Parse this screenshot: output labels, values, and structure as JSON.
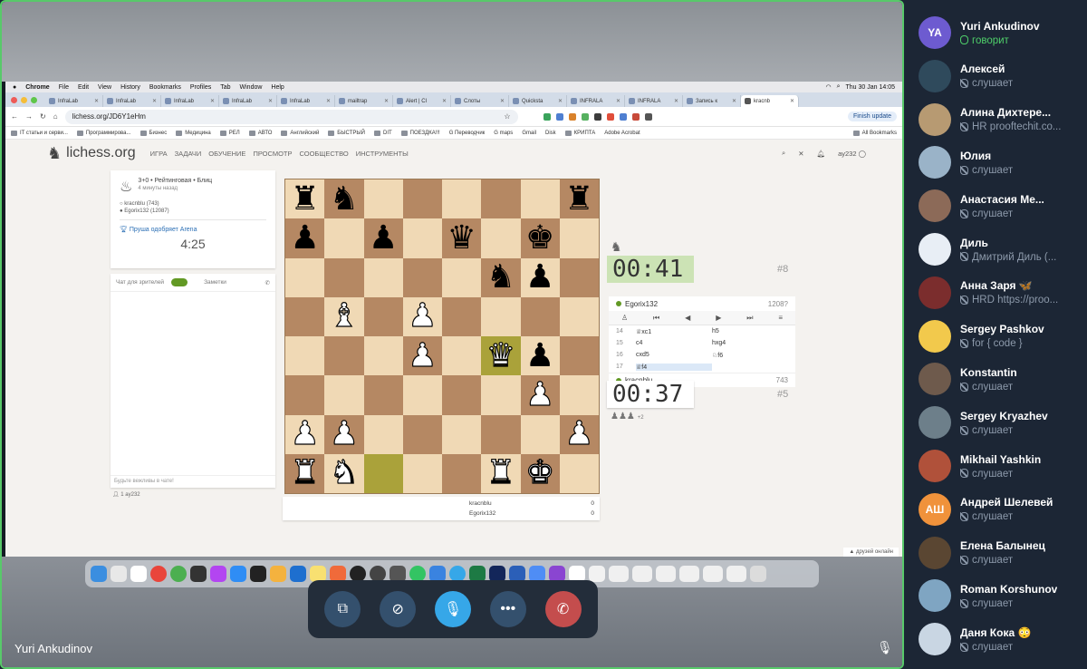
{
  "mac_menu": {
    "items": [
      "Chrome",
      "File",
      "Edit",
      "View",
      "History",
      "Bookmarks",
      "Profiles",
      "Tab",
      "Window",
      "Help"
    ],
    "clock": "Thu 30 Jan 14:05"
  },
  "tabs": [
    "InfraLab",
    "InfraLab",
    "InfraLab",
    "InfraLab",
    "InfraLab",
    "mailtrap",
    "Alert | Cl",
    "Слоты",
    "Quickstа",
    "INFRALA",
    "INFRALA",
    "Запись к",
    "kracnb"
  ],
  "address": {
    "url": "lichess.org/JD6Y1eHm",
    "finish_update": "Finish update"
  },
  "bookmarks": [
    "IT статьи и серви...",
    "Программирова...",
    "Бизнес",
    "Медицина",
    "РЕЛ",
    "АВТО",
    "Английский",
    "БЫСТРЫЙ",
    "DIT",
    "ПОЕЗДКА!!!",
    "G Переводчик",
    "G maps",
    "Gmail",
    "Disk",
    "КРИПТА",
    "Adobe Acrobat",
    "All Bookmarks"
  ],
  "lichess": {
    "logo": "lichess.org",
    "nav": [
      "ИГРА",
      "ЗАДАЧИ",
      "ОБУЧЕНИЕ",
      "ПРОСМОТР",
      "СООБЩЕСТВО",
      "ИНСТРУМЕНТЫ"
    ],
    "user": "ay232",
    "game": {
      "type": "3+0 • Рейтинговая • Блиц",
      "ago": "4 минуты назад",
      "white": "kracnblu (743)",
      "black": "Egorix132 (12087)",
      "arena": "Пруша одобряет Arena",
      "arena_time": "4:25"
    },
    "chat": {
      "tab1": "Чат для зрителей",
      "tab2": "Заметки",
      "placeholder": "Будьте вежливы в чате!",
      "spectators": "1  ay232"
    },
    "top_player": {
      "name": "Egorix132",
      "rating": "1208?",
      "clock": "00:41",
      "move_no": "#8"
    },
    "bottom_player": {
      "name": "kracnblu",
      "rating": "743",
      "clock": "00:37",
      "move_no": "#5",
      "material": "+2"
    },
    "moves": [
      [
        "14",
        "♕xc1",
        "h5"
      ],
      [
        "15",
        "c4",
        "hxg4"
      ],
      [
        "16",
        "cxd5",
        "♘f6"
      ],
      [
        "17",
        "♕f4",
        ""
      ]
    ],
    "score": [
      [
        "kracnblu",
        "0"
      ],
      [
        "Egorix132",
        "0"
      ]
    ],
    "friends": "друзей онлайн"
  },
  "board": [
    [
      "br",
      "bn",
      "",
      "",
      "",
      "",
      "",
      "br"
    ],
    [
      "bp",
      "",
      "bp",
      "",
      "bq",
      "",
      "bk",
      ""
    ],
    [
      "",
      "",
      "",
      "",
      "",
      "bn",
      "bp",
      ""
    ],
    [
      "",
      "wb",
      "",
      "wp",
      "",
      "",
      "",
      ""
    ],
    [
      "",
      "",
      "",
      "wp",
      "",
      "wq",
      "bp",
      ""
    ],
    [
      "",
      "",
      "",
      "",
      "",
      "",
      "wp",
      ""
    ],
    [
      "wp",
      "wp",
      "",
      "",
      "",
      "",
      "",
      "wp"
    ],
    [
      "wr",
      "wn",
      "",
      "",
      "",
      "wr",
      "wk",
      ""
    ]
  ],
  "speaker_name": "Yuri Ankudinov",
  "participants": [
    {
      "initials": "YA",
      "name": "Yuri Ankudinov",
      "status": "говорит",
      "talking": true,
      "color": "#6d5bd0"
    },
    {
      "initials": "",
      "name": "Алексей",
      "status": "слушает",
      "color": "#2f4a5c"
    },
    {
      "initials": "",
      "name": "Алина Дихтере...",
      "status": "HR prooftechit.co...",
      "color": "#b79a72"
    },
    {
      "initials": "",
      "name": "Юлия",
      "status": "слушает",
      "color": "#9ab3c8"
    },
    {
      "initials": "",
      "name": "Анастасия Ме...",
      "status": "слушает",
      "color": "#8c6a58"
    },
    {
      "initials": "",
      "name": "Диль",
      "status": "Дмитрий Диль (...",
      "color": "#e8eef5"
    },
    {
      "initials": "",
      "name": "Анна Заря 🦋",
      "status": "HRD https://proo...",
      "color": "#7b2d2d"
    },
    {
      "initials": "",
      "name": "Sergey Pashkov",
      "status": "for { code }",
      "color": "#f2c94c"
    },
    {
      "initials": "",
      "name": "Konstantin",
      "status": "слушает",
      "color": "#6e5a4c"
    },
    {
      "initials": "",
      "name": "Sergey Kryazhev",
      "status": "слушает",
      "color": "#6d7f8a"
    },
    {
      "initials": "",
      "name": "Mikhail Yashkin",
      "status": "слушает",
      "color": "#b0513a"
    },
    {
      "initials": "АШ",
      "name": "Андрей Шелевей",
      "status": "слушает",
      "color": "#f0923b"
    },
    {
      "initials": "",
      "name": "Елена Балынец",
      "status": "слушает",
      "color": "#5a4632"
    },
    {
      "initials": "",
      "name": "Roman Korshunov",
      "status": "слушает",
      "color": "#7fa5c2"
    },
    {
      "initials": "",
      "name": "Даня Кока 😳",
      "status": "слушает",
      "color": "#c9d6e3"
    }
  ]
}
